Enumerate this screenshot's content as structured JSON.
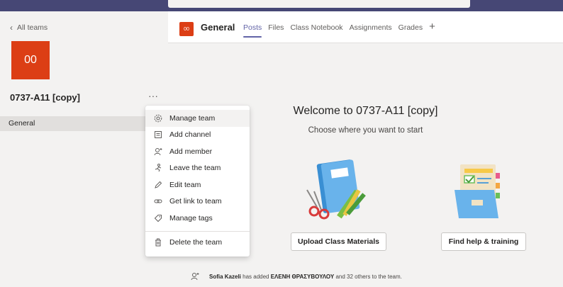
{
  "sidebar": {
    "back_label": "All teams",
    "team_avatar": "00",
    "team_name": "0737-A11 [copy]",
    "more_label": "···",
    "channels": [
      {
        "label": "General"
      }
    ]
  },
  "header": {
    "channel_avatar": "00",
    "channel_name": "General",
    "tabs": [
      {
        "label": "Posts",
        "active": true
      },
      {
        "label": "Files"
      },
      {
        "label": "Class Notebook"
      },
      {
        "label": "Assignments"
      },
      {
        "label": "Grades"
      }
    ],
    "add_tab_label": "+"
  },
  "welcome": {
    "title": "Welcome to 0737-A11 [copy]",
    "subtitle": "Choose where you want to start",
    "upload_button": "Upload Class Materials",
    "help_button": "Find help & training"
  },
  "activity": {
    "user": "Sofia Kazeli",
    "text_before": " has added ",
    "added_user": "ΕΛΕΝΗ ΘΡΑΣΥΒΟΥΛΟΥ",
    "text_after": " and 32 others to the team."
  },
  "menu": {
    "items": [
      {
        "label": "Manage team",
        "icon": "gear-icon"
      },
      {
        "label": "Add channel",
        "icon": "add-channel-icon"
      },
      {
        "label": "Add member",
        "icon": "add-member-icon"
      },
      {
        "label": "Leave the team",
        "icon": "leave-icon"
      },
      {
        "label": "Edit team",
        "icon": "pencil-icon"
      },
      {
        "label": "Get link to team",
        "icon": "link-icon"
      },
      {
        "label": "Manage tags",
        "icon": "tag-icon"
      },
      {
        "label": "Delete the team",
        "icon": "trash-icon"
      }
    ]
  },
  "colors": {
    "accent": "#6264a7",
    "topbar": "#464775",
    "team_avatar_bg": "#dc3e15"
  }
}
